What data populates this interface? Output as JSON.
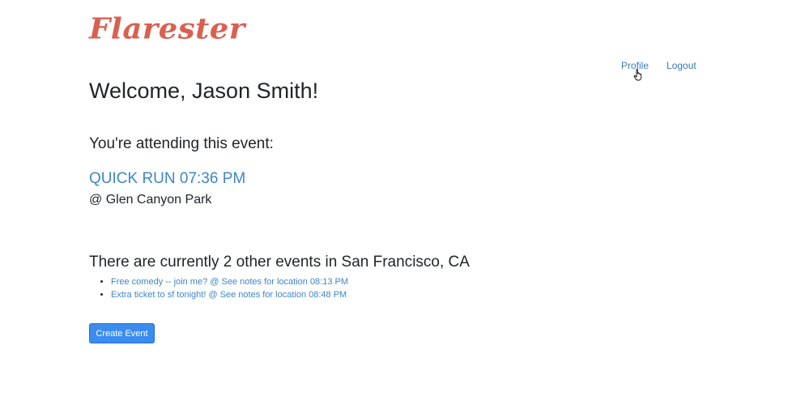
{
  "brand": {
    "logo_text": "Flarester",
    "color": "#d9604f"
  },
  "nav": {
    "profile_label": "Profile",
    "logout_label": "Logout",
    "link_color": "#3e78b6"
  },
  "welcome": {
    "text": "Welcome, Jason Smith!"
  },
  "attending": {
    "heading": "You're attending this event:",
    "event_title": "QUICK RUN 07:36 PM",
    "event_location": "@ Glen Canyon Park"
  },
  "other_events": {
    "heading": "There are currently 2 other events in San Francisco, CA",
    "items": [
      {
        "label": "Free comedy -- join me? @ See notes for location 08:13 PM"
      },
      {
        "label": "Extra ticket to sf tonight! @ See notes for location 08:48 PM"
      }
    ]
  },
  "actions": {
    "create_event_label": "Create Event",
    "button_color": "#3b8cf0"
  },
  "cursor": {
    "icon": "hand-pointer-icon"
  }
}
